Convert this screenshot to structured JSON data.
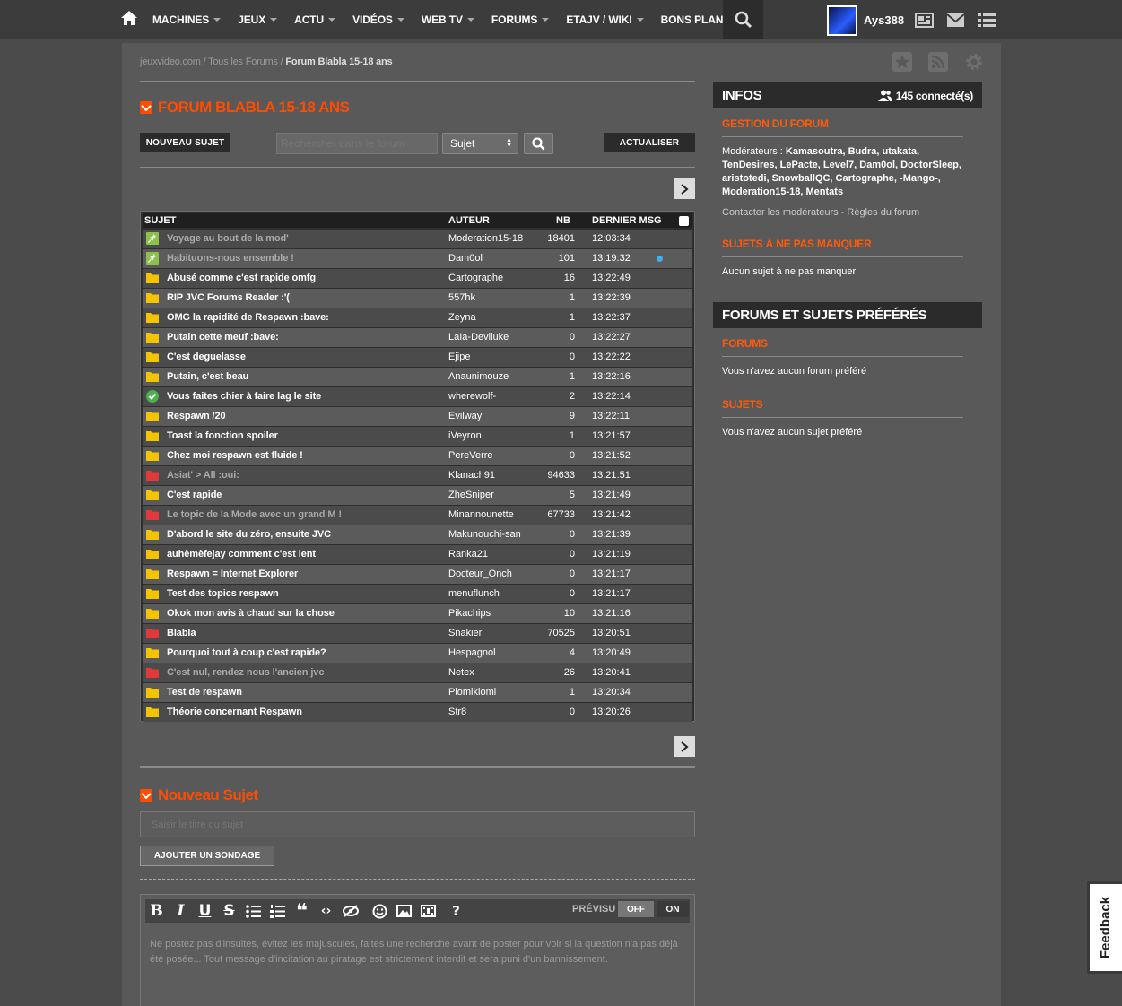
{
  "nav": {
    "items": [
      {
        "label": "MACHINES",
        "caret": true
      },
      {
        "label": "JEUX",
        "caret": true
      },
      {
        "label": "ACTU",
        "caret": true
      },
      {
        "label": "VIDÉOS",
        "caret": true
      },
      {
        "label": "WEB TV",
        "caret": true
      },
      {
        "label": "FORUMS",
        "caret": true
      },
      {
        "label": "ETAJV / WIKI",
        "caret": true
      },
      {
        "label": "BONS PLANS",
        "caret": false
      }
    ],
    "username": "Ays388"
  },
  "breadcrumb": {
    "site": "jeuxvideo.com",
    "sep1": " / ",
    "all": "Tous les Forums",
    "sep2": " / ",
    "current": "Forum Blabla 15-18 ans"
  },
  "forum": {
    "title": "FORUM BLABLA 15-18 ANS",
    "new_topic_label": "NOUVEAU SUJET",
    "search_placeholder": "Rechercher dans le forum",
    "search_type": "Sujet",
    "refresh_label": "ACTUALISER"
  },
  "table": {
    "headers": {
      "subject": "SUJET",
      "author": "AUTEUR",
      "nb": "NB",
      "last": "DERNIER MSG"
    },
    "rows": [
      {
        "icon": "pin",
        "subject": "Voyage au bout de la mod'",
        "author": "Moderation15-18",
        "nb": "18401",
        "last": "12:03:34",
        "dim": true
      },
      {
        "icon": "pin",
        "subject": "Habituons-nous ensemble !",
        "author": "Dam0ol",
        "nb": "101",
        "last": "13:19:32",
        "dim": true,
        "dot": true
      },
      {
        "icon": "folder",
        "subject": "Abusé comme c'est rapide omfg",
        "author": "Cartographe",
        "nb": "16",
        "last": "13:22:49"
      },
      {
        "icon": "folder",
        "subject": "RIP JVC Forums Reader :'(",
        "author": "557hk",
        "nb": "1",
        "last": "13:22:39"
      },
      {
        "icon": "folder",
        "subject": "OMG la rapidité de Respawn :bave:",
        "author": "Zeyna",
        "nb": "1",
        "last": "13:22:37"
      },
      {
        "icon": "folder",
        "subject": "Putain cette meuf :bave:",
        "author": "LaIa-Deviluke",
        "nb": "0",
        "last": "13:22:27"
      },
      {
        "icon": "folder",
        "subject": "C'est deguelasse",
        "author": "Ejipe",
        "nb": "0",
        "last": "13:22:22"
      },
      {
        "icon": "folder",
        "subject": "Putain, c'est beau",
        "author": "Anaunimouze",
        "nb": "1",
        "last": "13:22:16"
      },
      {
        "icon": "check",
        "subject": "Vous faites chier à faire lag le site",
        "author": "wherewolf-",
        "nb": "2",
        "last": "13:22:14"
      },
      {
        "icon": "folder",
        "subject": "Respawn /20",
        "author": "Evilway",
        "nb": "9",
        "last": "13:22:11"
      },
      {
        "icon": "folder",
        "subject": "Toast la fonction spoiler",
        "author": "iVeyron",
        "nb": "1",
        "last": "13:21:57"
      },
      {
        "icon": "folder",
        "subject": "Chez moi respawn est fluide !",
        "author": "PereVerre",
        "nb": "0",
        "last": "13:21:52"
      },
      {
        "icon": "red",
        "subject": "Asiat' > All :oui:",
        "author": "Klanach91",
        "nb": "94633",
        "last": "13:21:51",
        "dim": true
      },
      {
        "icon": "folder",
        "subject": "C'est rapide",
        "author": "ZheSniper",
        "nb": "5",
        "last": "13:21:49"
      },
      {
        "icon": "red",
        "subject": "Le topic de la Mode avec un grand M !",
        "author": "Minannounette",
        "nb": "67733",
        "last": "13:21:42",
        "dim": true
      },
      {
        "icon": "folder",
        "subject": "D'abord le site du zéro, ensuite JVC",
        "author": "Makunouchi-san",
        "nb": "0",
        "last": "13:21:39"
      },
      {
        "icon": "folder",
        "subject": "auhèmèfejay comment c'est lent",
        "author": "Ranka21",
        "nb": "0",
        "last": "13:21:19"
      },
      {
        "icon": "folder",
        "subject": "Respawn = Internet Explorer",
        "author": "Docteur_Onch",
        "nb": "0",
        "last": "13:21:17"
      },
      {
        "icon": "folder",
        "subject": "Test des topics respawn",
        "author": "menuflunch",
        "nb": "0",
        "last": "13:21:17"
      },
      {
        "icon": "folder",
        "subject": "Okok mon avis à chaud sur la chose",
        "author": "Pikachips",
        "nb": "10",
        "last": "13:21:16"
      },
      {
        "icon": "red",
        "subject": "Blabla",
        "author": "Snakier",
        "nb": "70525",
        "last": "13:20:51"
      },
      {
        "icon": "folder",
        "subject": "Pourquoi tout à coup c'est rapide?",
        "author": "Hespagnol",
        "nb": "4",
        "last": "13:20:49"
      },
      {
        "icon": "red",
        "subject": "C'est nul, rendez nous l'ancien jvc",
        "author": "Netex",
        "nb": "26",
        "last": "13:20:41",
        "dim": true
      },
      {
        "icon": "folder",
        "subject": "Test de respawn",
        "author": "Plomiklomi",
        "nb": "1",
        "last": "13:20:34"
      },
      {
        "icon": "folder",
        "subject": "Théorie concernant Respawn",
        "author": "Str8",
        "nb": "0",
        "last": "13:20:26"
      }
    ]
  },
  "new_topic": {
    "title": "Nouveau Sujet",
    "title_placeholder": "Saisir le titre du sujet",
    "poll_label": "AJOUTER UN SONDAGE",
    "preview_label": "PRÉVISU",
    "off_label": "OFF",
    "on_label": "ON",
    "message_placeholder": "Ne postez pas d'insultes, évitez les majuscules, faites une recherche avant de poster pour voir si la question n'a pas déjà été posée... Tout message d'incitation au piratage est strictement interdit et sera puni d'un bannissement."
  },
  "infos": {
    "title": "INFOS",
    "connected": "145 connecté(s)",
    "gestion_title": "GESTION DU FORUM",
    "moderators_prefix": "Modérateurs : ",
    "moderators": "Kamasoutra, Budra, utakata, TenDesires, LePacte, Level7, Dam0ol, DoctorSleep, aristotedi, SnowballQC, Cartographe, -Mango-, Moderation15-18, Mentats",
    "contact": "Contacter les modérateurs",
    "contact_sep": " - ",
    "rules": "Règles du forum",
    "missing_title": "SUJETS À NE PAS MANQUER",
    "missing_text": "Aucun sujet à ne pas manquer"
  },
  "favorites": {
    "title": "FORUMS ET SUJETS PRÉFÉRÉS",
    "forums_title": "FORUMS",
    "forums_text": "Vous n'avez aucun forum préféré",
    "topics_title": "SUJETS",
    "topics_text": "Vous n'avez aucun sujet préféré"
  },
  "feedback_label": "Feedback",
  "colors": {
    "accent": "#ff4c00",
    "folder": "#f5c400",
    "folder_red": "#e03a3a",
    "pin": "#8bc34a",
    "check": "#4caf50"
  }
}
